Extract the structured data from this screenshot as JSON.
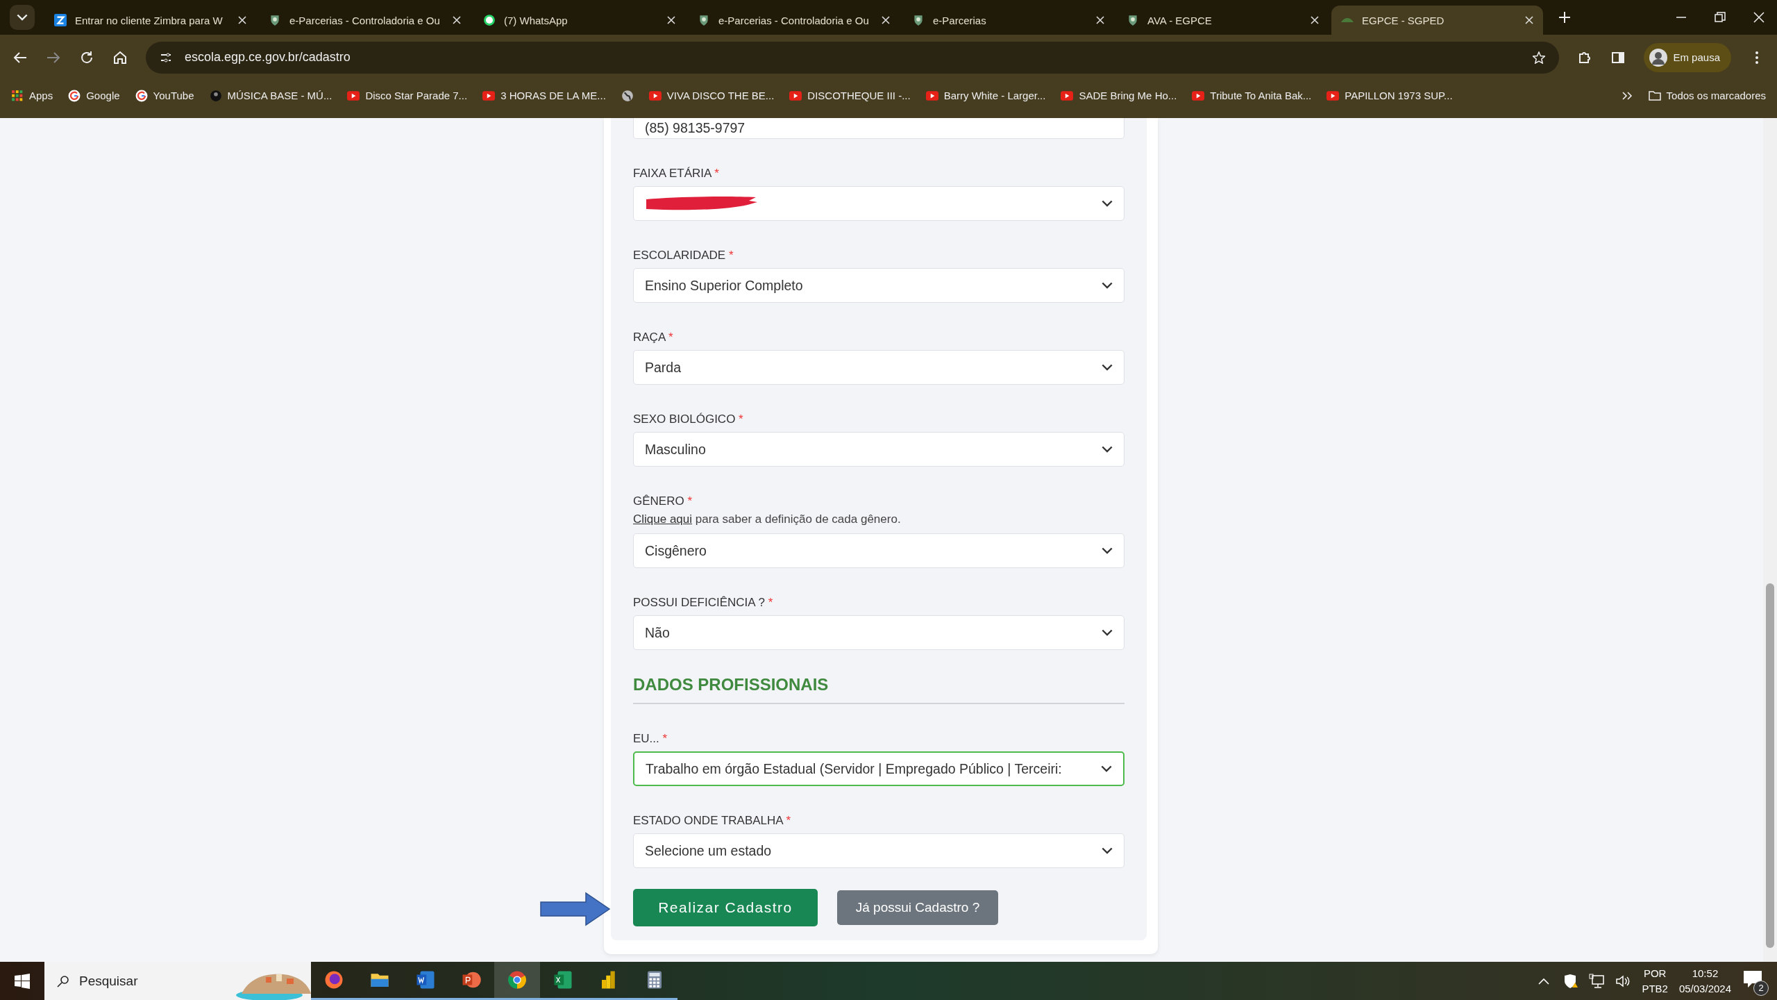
{
  "browser": {
    "tabs": [
      {
        "title": "Entrar no cliente Zimbra para W",
        "kind": "zimbra",
        "selected": false
      },
      {
        "title": "e-Parcerias - Controladoria e Ou",
        "kind": "emblem",
        "selected": false
      },
      {
        "title": "(7) WhatsApp",
        "kind": "chat",
        "selected": false
      },
      {
        "title": "e-Parcerias - Controladoria e Ou",
        "kind": "emblem",
        "selected": false
      },
      {
        "title": "e-Parcerias",
        "kind": "emblem",
        "selected": false
      },
      {
        "title": "AVA - EGPCE",
        "kind": "emblem",
        "selected": false
      },
      {
        "title": "EGPCE - SGPED",
        "kind": "leaf",
        "selected": true
      }
    ],
    "url": "escola.egp.ce.gov.br/cadastro",
    "profile": "Em pausa",
    "bookmarks": [
      {
        "label": "Apps",
        "kind": "apps"
      },
      {
        "label": "Google",
        "kind": "google"
      },
      {
        "label": "YouTube",
        "kind": "google"
      },
      {
        "label": "MÚSICA BASE - MÚ...",
        "kind": "avatar"
      },
      {
        "label": "Disco Star Parade 7...",
        "kind": "video"
      },
      {
        "label": "3 HORAS DE LA ME...",
        "kind": "video"
      },
      {
        "kind": "globe"
      },
      {
        "label": "VIVA DISCO THE BE...",
        "kind": "video"
      },
      {
        "label": "DISCOTHEQUE III -...",
        "kind": "video"
      },
      {
        "label": "Barry White - Larger...",
        "kind": "video"
      },
      {
        "label": "SADE Bring Me Ho...",
        "kind": "video"
      },
      {
        "label": "Tribute To Anita Bak...",
        "kind": "video"
      },
      {
        "label": "PAPILLON 1973 SUP...",
        "kind": "video"
      }
    ],
    "all_bookmarks": "Todos os marcadores"
  },
  "form": {
    "top_field_value": "(85) 98135-9797",
    "fields": [
      {
        "label": "FAIXA ETÁRIA",
        "required_mark": "*",
        "redacted": true,
        "focused": false
      },
      {
        "label": "ESCOLARIDADE",
        "required_mark": "*",
        "value": "Ensino Superior Completo",
        "redacted": false,
        "focused": false
      },
      {
        "label": "RAÇA",
        "required_mark": "*",
        "value": "Parda",
        "redacted": false,
        "focused": false
      },
      {
        "label": "SEXO BIOLÓGICO",
        "required_mark": "*",
        "value": "Masculino",
        "redacted": false,
        "focused": false
      },
      {
        "label": "GÊNERO",
        "required_mark": "*",
        "help_link": "Clique aqui",
        "help_text": " para saber a definição de cada gênero.",
        "value": "Cisgênero",
        "redacted": false,
        "focused": false
      },
      {
        "label": "POSSUI DEFICIÊNCIA ?",
        "required_mark": "*",
        "value": "Não",
        "redacted": false,
        "focused": false
      }
    ],
    "section_title": "DADOS PROFISSIONAIS",
    "professional_fields": [
      {
        "label": "EU...",
        "required_mark": "*",
        "value": "Trabalho em órgão Estadual (Servidor | Empregado Público | Terceiri:",
        "redacted": false,
        "focused": true
      },
      {
        "label": "ESTADO ONDE TRABALHA",
        "required_mark": "*",
        "value": "Selecione um estado",
        "redacted": false,
        "focused": false
      }
    ],
    "primary_button": "Realizar Cadastro",
    "secondary_button": "Já possui Cadastro ?"
  },
  "taskbar": {
    "search_placeholder": "Pesquisar",
    "apps": [
      {
        "kind": "firefox",
        "selected": false
      },
      {
        "kind": "folder",
        "selected": false
      },
      {
        "kind": "word",
        "selected": false
      },
      {
        "kind": "powerpoint",
        "selected": false
      },
      {
        "kind": "chrome",
        "selected": true
      },
      {
        "kind": "excel",
        "selected": false
      },
      {
        "kind": "chart",
        "selected": false
      },
      {
        "kind": "calculator",
        "selected": false
      }
    ],
    "language": "POR",
    "layout": "PTB2",
    "time": "10:52",
    "date": "05/03/2024",
    "notifications": "2"
  }
}
